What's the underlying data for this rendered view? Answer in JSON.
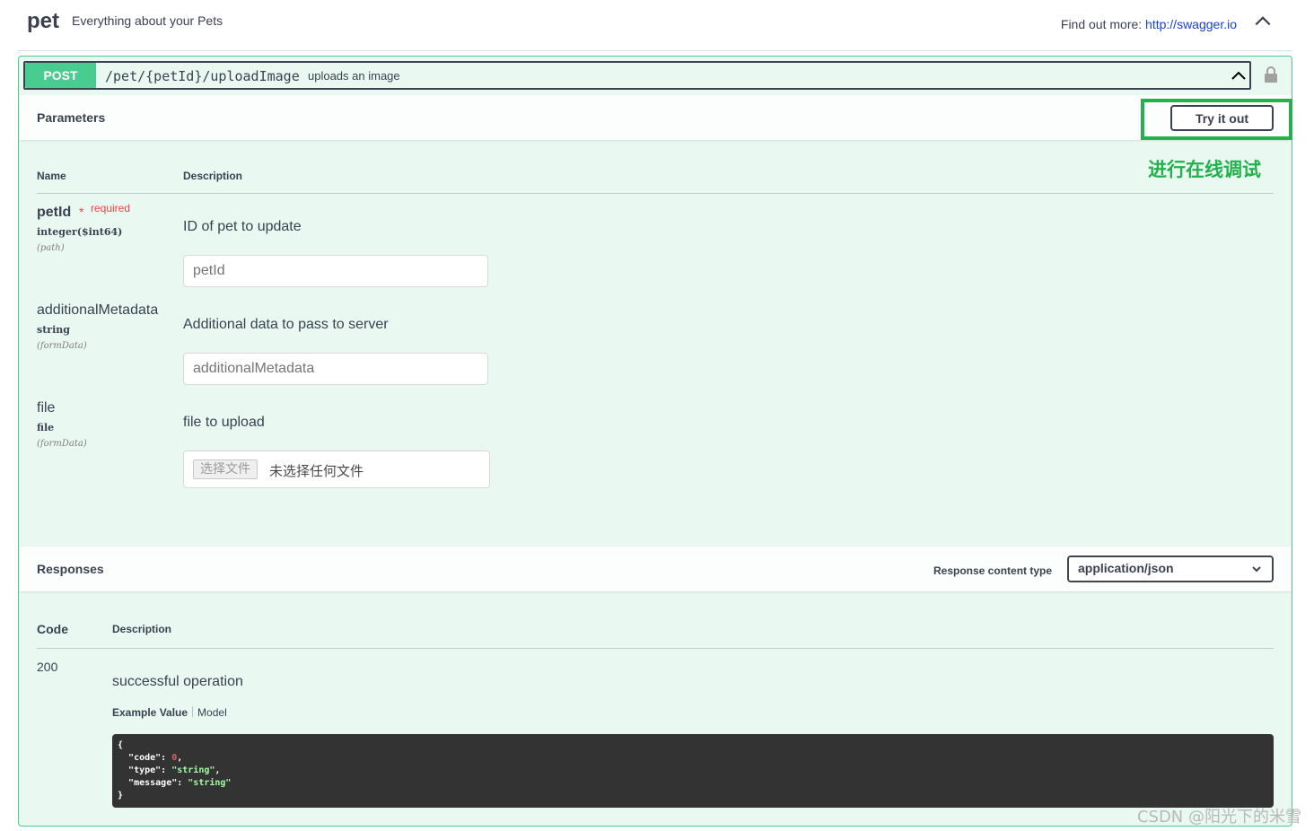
{
  "tag": {
    "name": "pet",
    "description": "Everything about your Pets",
    "find_more_label": "Find out more:",
    "find_more_link": "http://swagger.io"
  },
  "operation": {
    "method": "POST",
    "path": "/pet/{petId}/uploadImage",
    "summary": "uploads an image"
  },
  "parameters": {
    "title": "Parameters",
    "try_it_out_label": "Try it out",
    "annotation": "进行在线调试",
    "col_name": "Name",
    "col_description": "Description",
    "items": [
      {
        "name": "petId",
        "required_star": "*",
        "required_label": "required",
        "type": "integer($int64)",
        "in": "(path)",
        "description": "ID of pet to update",
        "placeholder": "petId"
      },
      {
        "name": "additionalMetadata",
        "type": "string",
        "in": "(formData)",
        "description": "Additional data to pass to server",
        "placeholder": "additionalMetadata"
      },
      {
        "name": "file",
        "type": "file",
        "in": "(formData)",
        "description": "file to upload",
        "file_button": "选择文件",
        "file_status": "未选择任何文件"
      }
    ]
  },
  "responses": {
    "title": "Responses",
    "content_type_label": "Response content type",
    "content_type_value": "application/json",
    "col_code": "Code",
    "col_description": "Description",
    "rows": [
      {
        "code": "200",
        "description": "successful operation",
        "example_tab": "Example Value",
        "model_tab": "Model"
      }
    ],
    "example_json": {
      "open": "{",
      "code_key": "\"code\"",
      "code_val": "0",
      "type_key": "\"type\"",
      "type_val": "\"string\"",
      "message_key": "\"message\"",
      "message_val": "\"string\"",
      "close": "}"
    }
  },
  "watermark": "CSDN @阳光下的米雪",
  "colors": {
    "post": "#49cc90",
    "highlight": "#22b14c",
    "required": "#f93e3e"
  },
  "icons": [
    "chevron-up-icon",
    "lock-icon",
    "chevron-down-icon"
  ]
}
